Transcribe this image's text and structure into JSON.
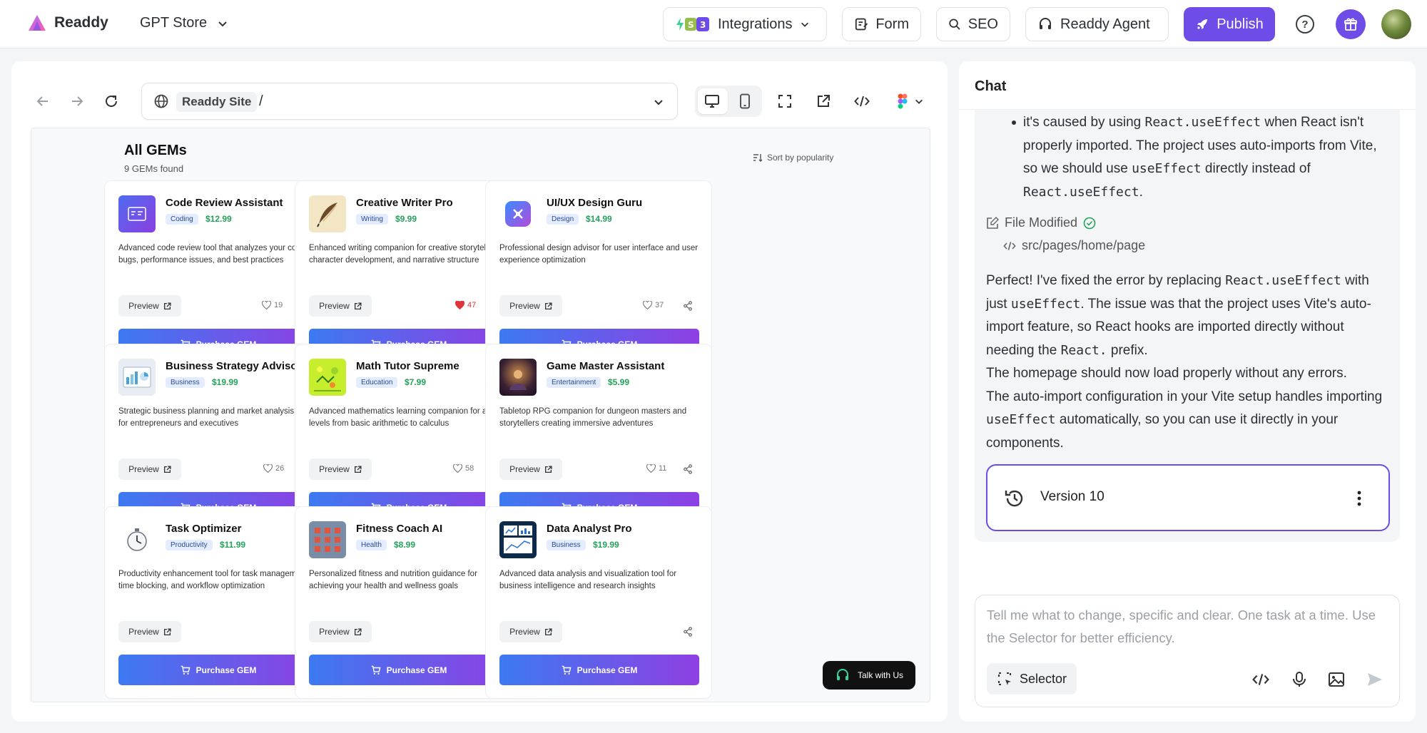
{
  "app": {
    "brand": "Readdy",
    "store_label": "GPT Store",
    "nav": {
      "integrations": "Integrations",
      "form": "Form",
      "seo": "SEO",
      "agent": "Readdy Agent",
      "publish": "Publish"
    },
    "help_label": "?"
  },
  "preview": {
    "site_chip": "Readdy Site",
    "path": "/",
    "page": {
      "title": "All GEMs",
      "count": "9 GEMs found",
      "sort": "Sort by popularity",
      "preview_label": "Preview",
      "purchase_label": "Purchase GEM",
      "cards": [
        {
          "name": "Code Review Assistant",
          "tag": "Coding",
          "price": "$12.99",
          "desc": "Advanced code review tool that analyzes your code for bugs, performance issues, and best practices",
          "likes": "19",
          "liked": false
        },
        {
          "name": "Creative Writer Pro",
          "tag": "Writing",
          "price": "$9.99",
          "desc": "Enhanced writing companion for creative storytelling, character development, and narrative structure",
          "likes": "47",
          "liked": true
        },
        {
          "name": "UI/UX Design Guru",
          "tag": "Design",
          "price": "$14.99",
          "desc": "Professional design advisor for user interface and user experience optimization",
          "likes": "37",
          "liked": false
        },
        {
          "name": "Business Strategy Advisor",
          "tag": "Business",
          "price": "$19.99",
          "desc": "Strategic business planning and market analysis tool for entrepreneurs and executives",
          "likes": "26",
          "liked": false
        },
        {
          "name": "Math Tutor Supreme",
          "tag": "Education",
          "price": "$7.99",
          "desc": "Advanced mathematics learning companion for all levels from basic arithmetic to calculus",
          "likes": "58",
          "liked": false
        },
        {
          "name": "Game Master Assistant",
          "tag": "Entertainment",
          "price": "$5.99",
          "desc": "Tabletop RPG companion for dungeon masters and storytellers creating immersive adventures",
          "likes": "11",
          "liked": false
        },
        {
          "name": "Task Optimizer",
          "tag": "Productivity",
          "price": "$11.99",
          "desc": "Productivity enhancement tool for task management, time blocking, and workflow optimization",
          "likes": "",
          "liked": false
        },
        {
          "name": "Fitness Coach AI",
          "tag": "Health",
          "price": "$8.99",
          "desc": "Personalized fitness and nutrition guidance for achieving your health and wellness goals",
          "likes": "",
          "liked": false
        },
        {
          "name": "Data Analyst Pro",
          "tag": "Business",
          "price": "$19.99",
          "desc": "Advanced data analysis and visualization tool for business intelligence and research insights",
          "likes": "",
          "liked": false
        }
      ]
    },
    "talk_label": "Talk with Us"
  },
  "chat": {
    "title": "Chat",
    "bullet": {
      "t1": "it's caused by using ",
      "c1": "React.useEffect",
      "t2": " when React isn't properly imported. The project uses auto-imports from Vite, so we should use ",
      "c2": "useEffect",
      "t3": " directly instead of ",
      "c3": "React.useEffect",
      "t4": "."
    },
    "file_modified": "File Modified",
    "file_path": "src/pages/home/page",
    "reply": {
      "t1": "Perfect! I've fixed the error by replacing ",
      "c1": "React.useEffect",
      "t2": " with just ",
      "c2": "useEffect",
      "t3": ". The issue was that the project uses Vite's auto-import feature, so React hooks are imported directly without needing the ",
      "c3": "React.",
      "t4": " prefix.",
      "p2": "The homepage should now load properly without any errors.",
      "p3a": "The auto-import configuration in your Vite setup handles importing ",
      "p3c": "useEffect",
      "p3b": " automatically, so you can use it directly in your components."
    },
    "version_label": "Version 10",
    "composer_placeholder": "Tell me what to change, specific and clear. One task at a time. Use the Selector for better efficiency.",
    "selector_label": "Selector"
  },
  "colors": {
    "accent": "#6d4ce8",
    "price": "#23a35a",
    "liked": "#e0333a"
  }
}
